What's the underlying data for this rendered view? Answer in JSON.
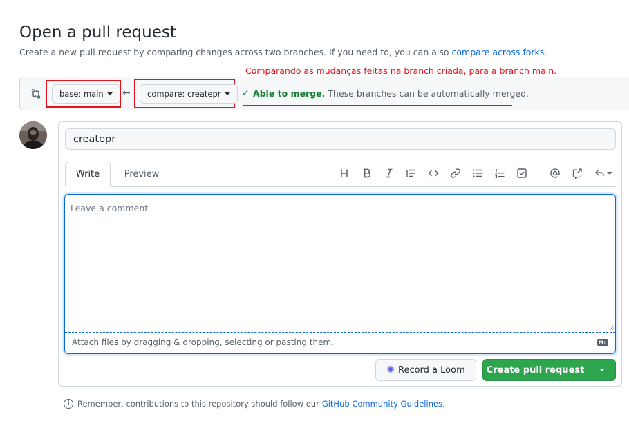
{
  "header": {
    "title": "Open a pull request",
    "subtitle": "Create a new pull request by comparing changes across two branches. If you need to, you can also",
    "subtitle_link": "compare across forks",
    "subtitle_end": "."
  },
  "annotation": {
    "text": "Comparando as mudanças feitas na branch criada, para a branch main.",
    "color": "#e3121b"
  },
  "range": {
    "base_label": "base: main",
    "compare_label": "compare: createpr",
    "merge_status_strong": "Able to merge.",
    "merge_status_text": "These branches can be automatically merged."
  },
  "form": {
    "title_value": "createpr",
    "tabs": [
      "Write",
      "Preview"
    ],
    "comment_placeholder": "Leave a comment",
    "attach_text": "Attach files by dragging & dropping, selecting or pasting them.",
    "markdown_badge": "M↓",
    "toolbar_icons": [
      "heading-icon",
      "bold-icon",
      "italic-icon",
      "quote-icon",
      "code-icon",
      "link-icon",
      "unordered-list-icon",
      "ordered-list-icon",
      "task-list-icon",
      "mention-icon",
      "cross-reference-icon",
      "reply-icon"
    ]
  },
  "actions": {
    "loom_label": "Record a Loom",
    "create_label": "Create pull request"
  },
  "footer": {
    "text": "Remember, contributions to this repository should follow our",
    "link": "GitHub Community Guidelines",
    "end": "."
  },
  "colors": {
    "accent": "#0969da",
    "success": "#2da44e",
    "highlight": "#e3121b"
  }
}
